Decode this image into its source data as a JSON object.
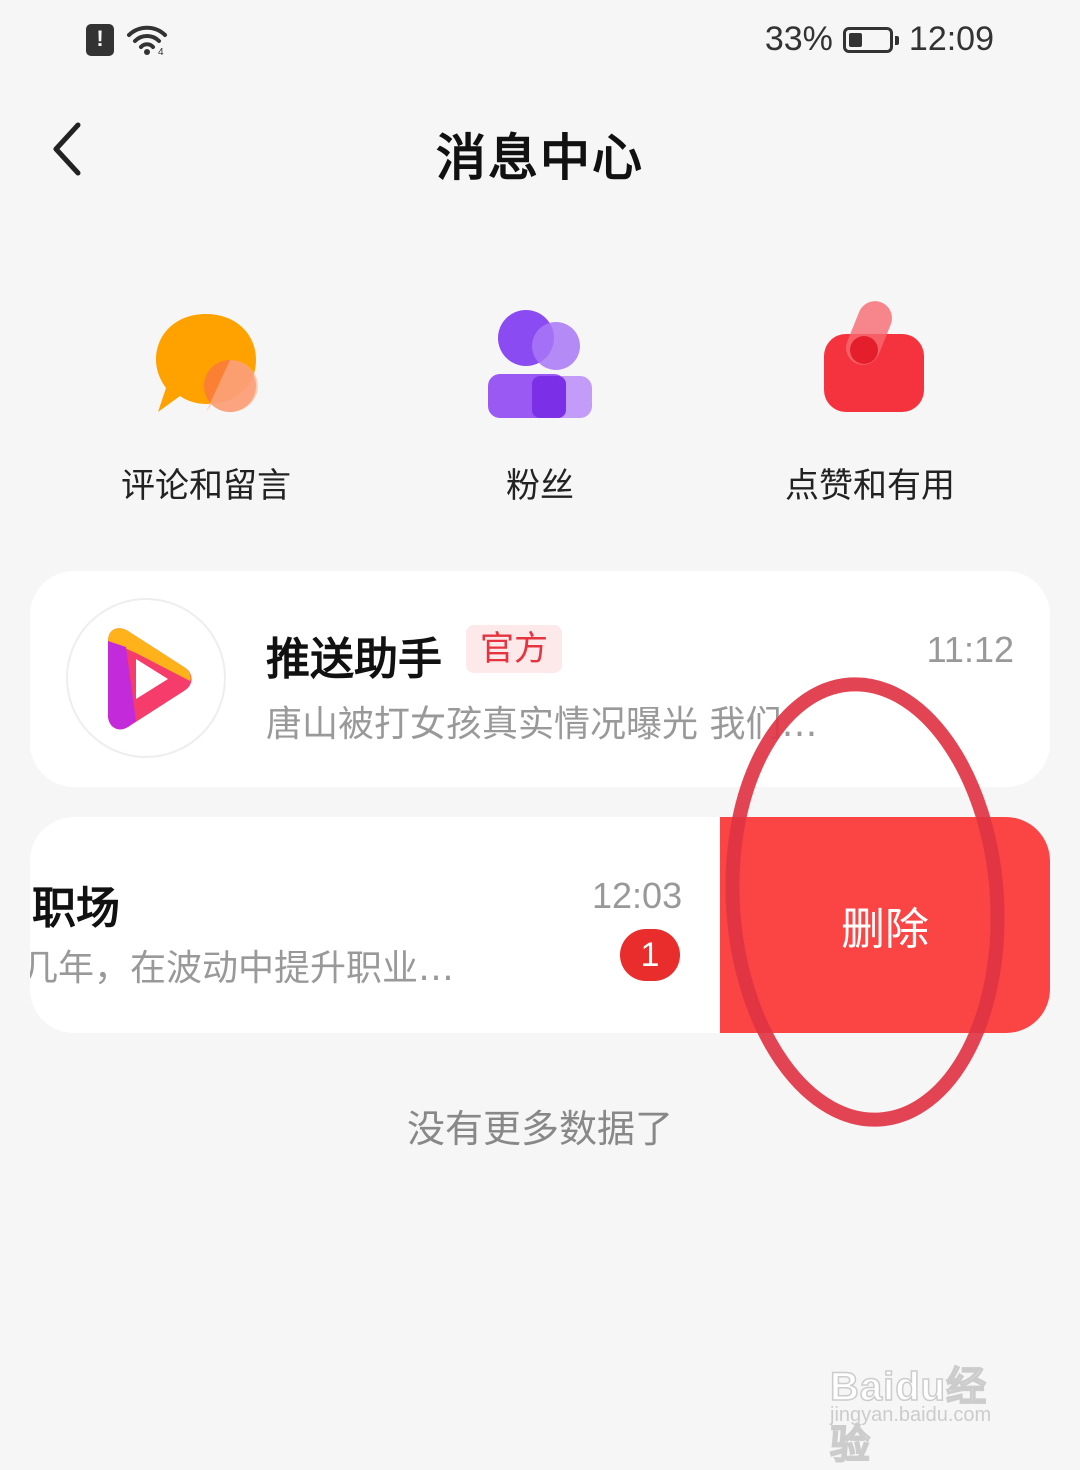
{
  "status_bar": {
    "battery_percent_text": "33%",
    "battery_level": 0.33,
    "time": "12:09",
    "icons": [
      "sim-alert-icon",
      "wifi-icon"
    ]
  },
  "header": {
    "title": "消息中心",
    "back_icon": "chevron-left-icon"
  },
  "categories": [
    {
      "label": "评论和留言",
      "icon": "comment-bubble-icon",
      "color": "#ffa200"
    },
    {
      "label": "粉丝",
      "icon": "fans-icon",
      "color": "#8a4bf2"
    },
    {
      "label": "点赞和有用",
      "icon": "thumbs-up-icon",
      "color": "#f5333f"
    }
  ],
  "messages": [
    {
      "name": "推送助手",
      "badge": "官方",
      "time": "11:12",
      "preview": "唐山被打女孩真实情况曝光 我们…",
      "avatar_icon": "play-logo-icon"
    },
    {
      "name": "职场",
      "time": "12:03",
      "preview": "几年，在波动中提升职业…",
      "unread": "1",
      "delete_label": "删除"
    }
  ],
  "footer": {
    "no_more": "没有更多数据了"
  },
  "watermark": {
    "logo": "Baidu经验",
    "url": "jingyan.baidu.com"
  },
  "colors": {
    "background": "#f6f6f6",
    "delete": "#fb4545",
    "badge_red": "#e92c2c",
    "official_bg": "#fde8ea",
    "official_text": "#e5333f",
    "annotation": "#e03444"
  }
}
